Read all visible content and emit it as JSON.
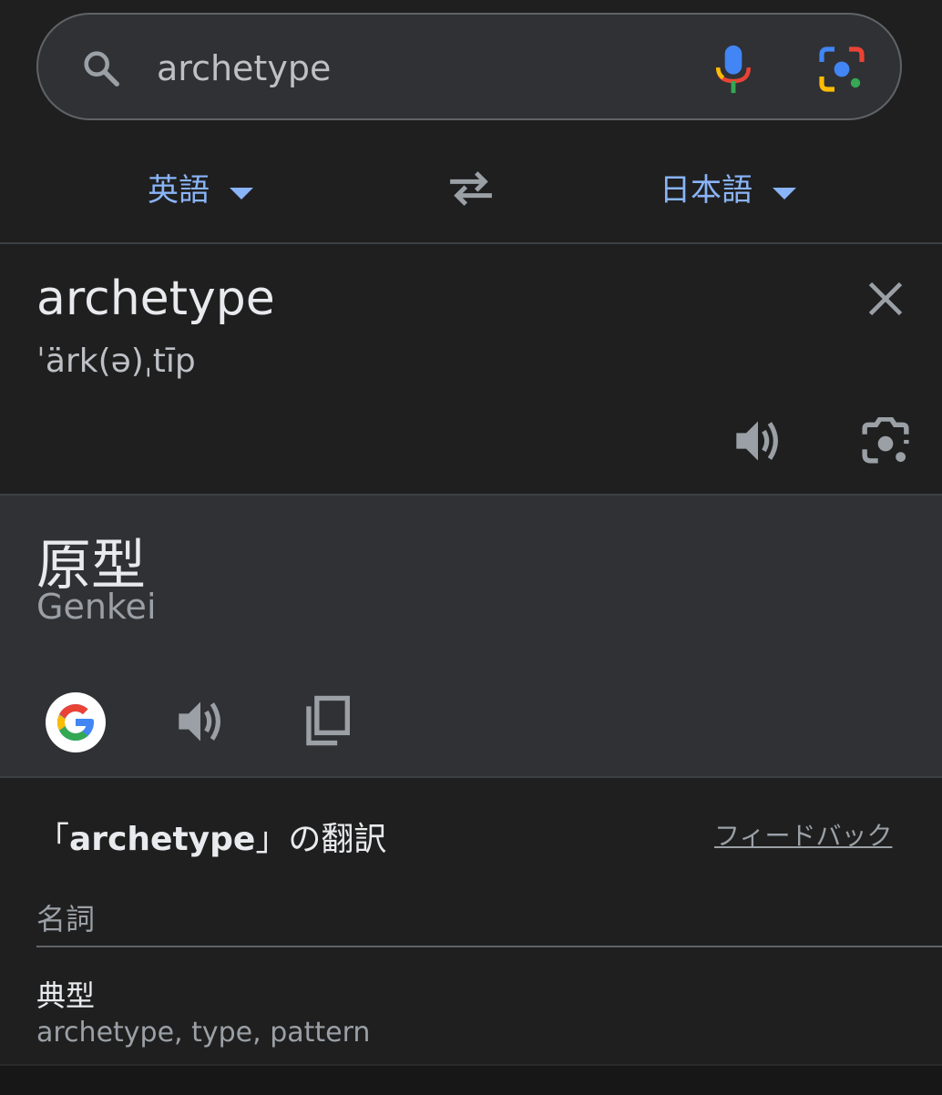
{
  "search": {
    "query": "archetype"
  },
  "language_bar": {
    "source_lang": "英語",
    "target_lang": "日本語"
  },
  "source": {
    "word": "archetype",
    "phonetic": "ˈärk(ə)ˌtīp"
  },
  "result": {
    "translation": "原型",
    "romanization": "Genkei"
  },
  "translations": {
    "title_prefix": "「",
    "title_term": "archetype",
    "title_suffix": "」の翻訳",
    "feedback_label": "フィードバック",
    "part_of_speech": "名詞",
    "entries": [
      {
        "word": "典型",
        "synonyms": "archetype, type, pattern"
      }
    ]
  },
  "colors": {
    "accent": "#8ab4f8",
    "background": "#1f1f1f",
    "panel": "#303134"
  }
}
